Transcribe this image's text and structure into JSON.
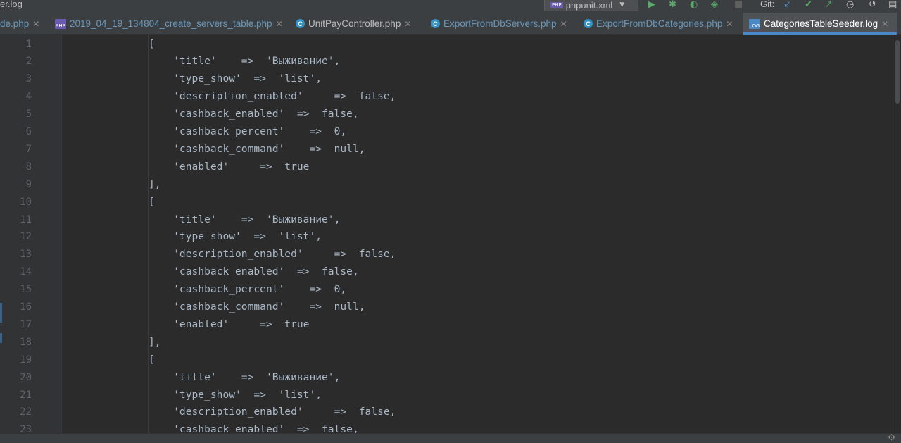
{
  "window": {
    "file_title": "er.log"
  },
  "toolbar": {
    "run_config_label": "phpunit.xml",
    "run_config_badge": "PHP",
    "git_label": "Git:",
    "colors": {
      "run": "#59a869",
      "debug": "#59a869",
      "git_update": "#4a88c7",
      "git_commit": "#59a869",
      "git_push": "#59a869"
    }
  },
  "tabs": [
    {
      "label": "de.php",
      "icon": "php-file-icon",
      "active": false
    },
    {
      "label": "2019_04_19_134804_create_servers_table.php",
      "icon": "php-file-icon",
      "badge": "PHP",
      "active": false
    },
    {
      "label": "UnitPayController.php",
      "icon": "class-icon",
      "badge": "C",
      "active": false
    },
    {
      "label": "ExportFromDbServers.php",
      "icon": "class-icon",
      "badge": "C",
      "active": false
    },
    {
      "label": "ExportFromDbCategories.php",
      "icon": "class-icon",
      "badge": "C",
      "active": false
    },
    {
      "label": "CategoriesTableSeeder.log",
      "icon": "log-file-icon",
      "badge": "LOG",
      "active": true
    }
  ],
  "editor": {
    "lines": [
      {
        "n": "1",
        "text": "              ["
      },
      {
        "n": "2",
        "text": "                  'title'    =>  'Выживание',"
      },
      {
        "n": "3",
        "text": "                  'type_show'  =>  'list',"
      },
      {
        "n": "4",
        "text": "                  'description_enabled'     =>  false,"
      },
      {
        "n": "5",
        "text": "                  'cashback_enabled'  =>  false,"
      },
      {
        "n": "6",
        "text": "                  'cashback_percent'    =>  0,"
      },
      {
        "n": "7",
        "text": "                  'cashback_command'    =>  null,"
      },
      {
        "n": "8",
        "text": "                  'enabled'     =>  true"
      },
      {
        "n": "9",
        "text": "              ],"
      },
      {
        "n": "10",
        "text": "              ["
      },
      {
        "n": "11",
        "text": "                  'title'    =>  'Выживание',"
      },
      {
        "n": "12",
        "text": "                  'type_show'  =>  'list',"
      },
      {
        "n": "13",
        "text": "                  'description_enabled'     =>  false,"
      },
      {
        "n": "14",
        "text": "                  'cashback_enabled'  =>  false,"
      },
      {
        "n": "15",
        "text": "                  'cashback_percent'    =>  0,"
      },
      {
        "n": "16",
        "text": "                  'cashback_command'    =>  null,"
      },
      {
        "n": "17",
        "text": "                  'enabled'     =>  true"
      },
      {
        "n": "18",
        "text": "              ],"
      },
      {
        "n": "19",
        "text": "              ["
      },
      {
        "n": "20",
        "text": "                  'title'    =>  'Выживание',"
      },
      {
        "n": "21",
        "text": "                  'type_show'  =>  'list',"
      },
      {
        "n": "22",
        "text": "                  'description_enabled'     =>  false,"
      },
      {
        "n": "23",
        "text": "                  'cashback_enabled'  =>  false,"
      }
    ]
  }
}
